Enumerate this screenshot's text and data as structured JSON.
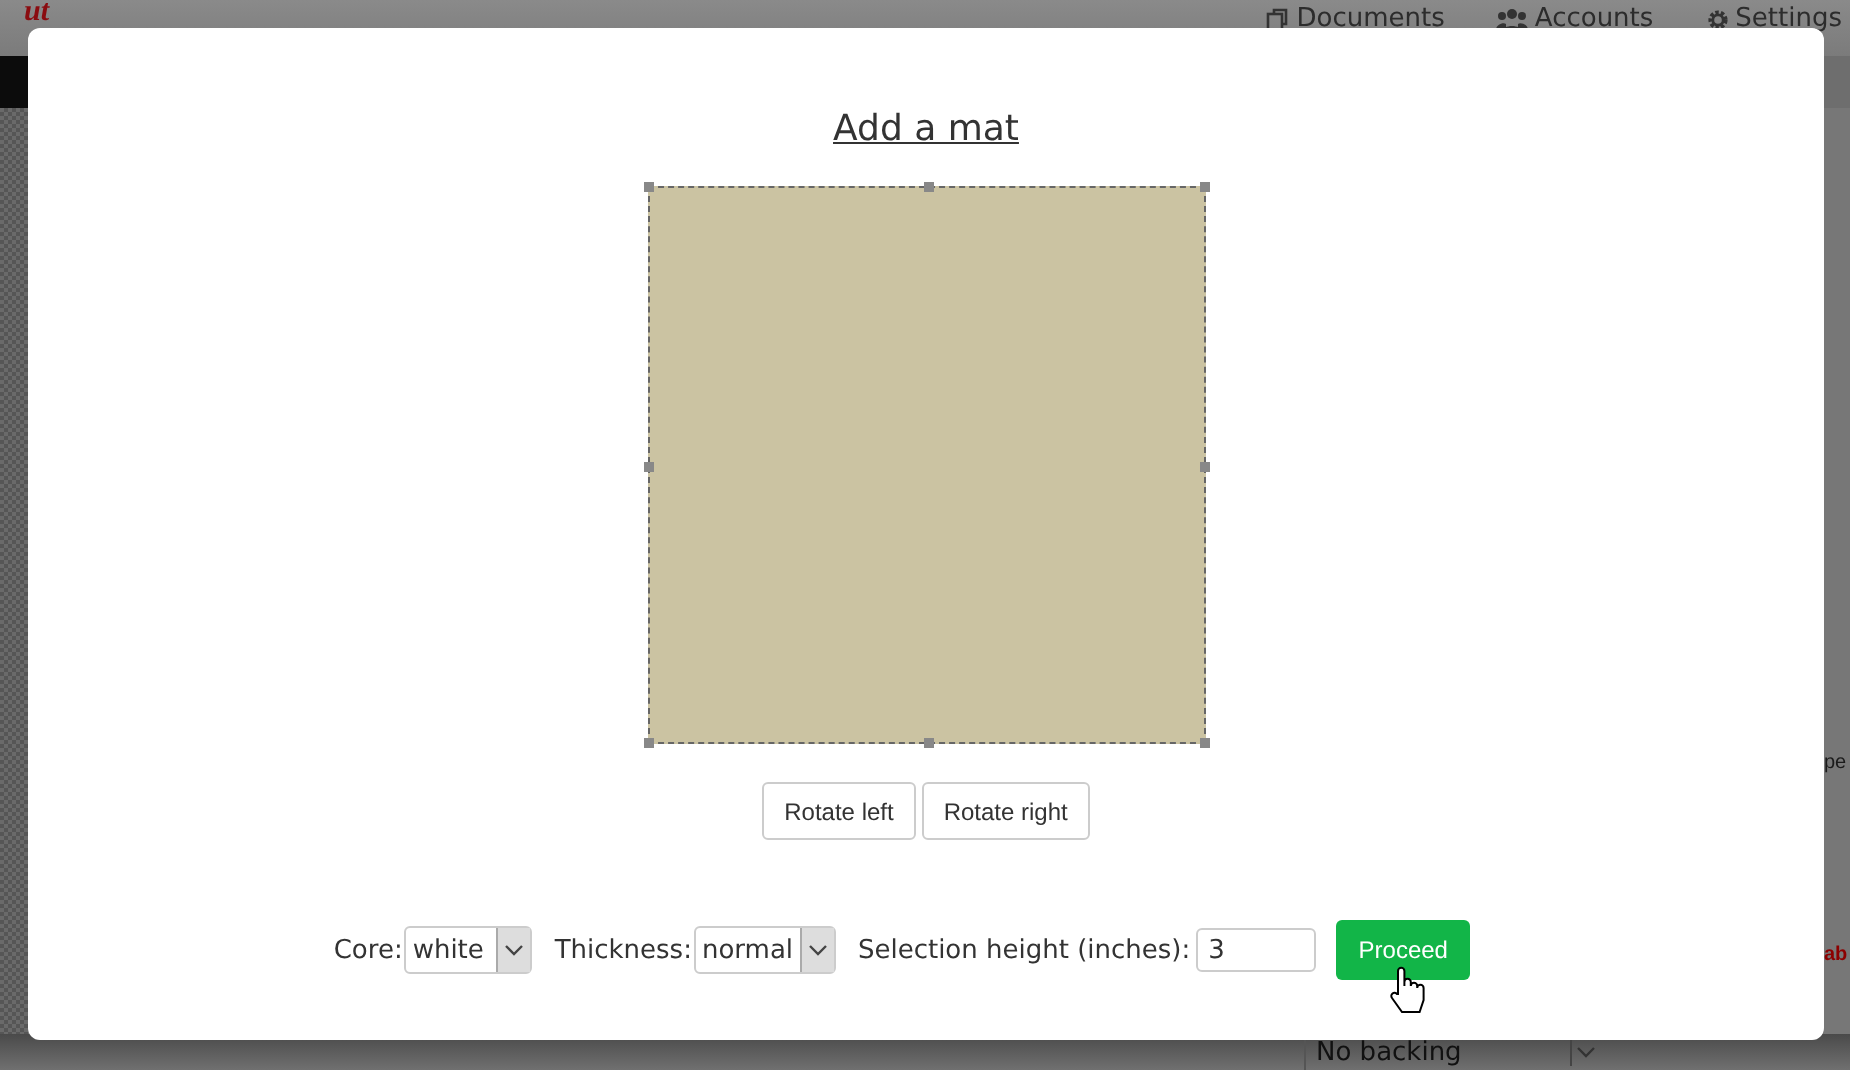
{
  "background": {
    "logo": "ut",
    "nav": [
      {
        "label": "Documents"
      },
      {
        "label": "Accounts"
      },
      {
        "label": "Settings"
      }
    ],
    "side_fragments": [
      {
        "text": "pe",
        "kind": "plain"
      },
      {
        "text": "ab",
        "kind": "alert"
      }
    ],
    "backing_select": {
      "value": "No backing"
    }
  },
  "dialog": {
    "title": "Add a mat",
    "rotate_buttons": [
      "Rotate left",
      "Rotate right"
    ],
    "core": {
      "label": "Core:",
      "value": "white"
    },
    "thickness": {
      "label": "Thickness:",
      "value": "normal"
    },
    "height": {
      "label": "Selection height (inches):",
      "value": "3"
    },
    "proceed": "Proceed"
  }
}
